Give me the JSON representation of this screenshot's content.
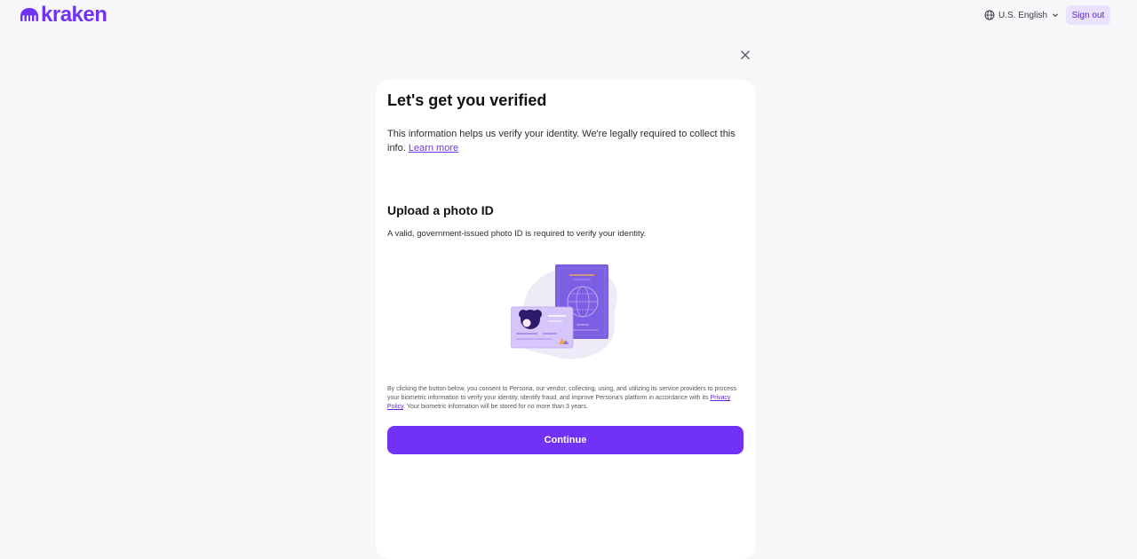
{
  "header": {
    "logo_text": "kraken",
    "language_label": "U.S. English",
    "signout_label": "Sign out"
  },
  "card": {
    "title": "Let's get you verified",
    "intro_text": "This information helps us verify your identity. We're legally required to collect this info. ",
    "learn_more_label": "Learn more",
    "subtitle": "Upload a photo ID",
    "subtext": "A valid, government-issued photo ID is required to verify your identity.",
    "consent_before": "By clicking the button below, you consent to Persona, our vendor, collecting, using, and utilizing its service providers to process your biometric information to verify your identity, identify fraud, and improve Persona's platform in accordance with its ",
    "privacy_label": "Privacy Policy",
    "consent_after": ". Your biometric information will be stored for no more than 3 years.",
    "continue_label": "Continue"
  },
  "icons": {
    "globe": "globe-icon",
    "chevron": "chevron-down-icon",
    "close": "close-icon"
  },
  "colors": {
    "brand": "#7132f5",
    "signout_bg": "#e9e1fd",
    "page_bg": "#f7f7f9"
  }
}
